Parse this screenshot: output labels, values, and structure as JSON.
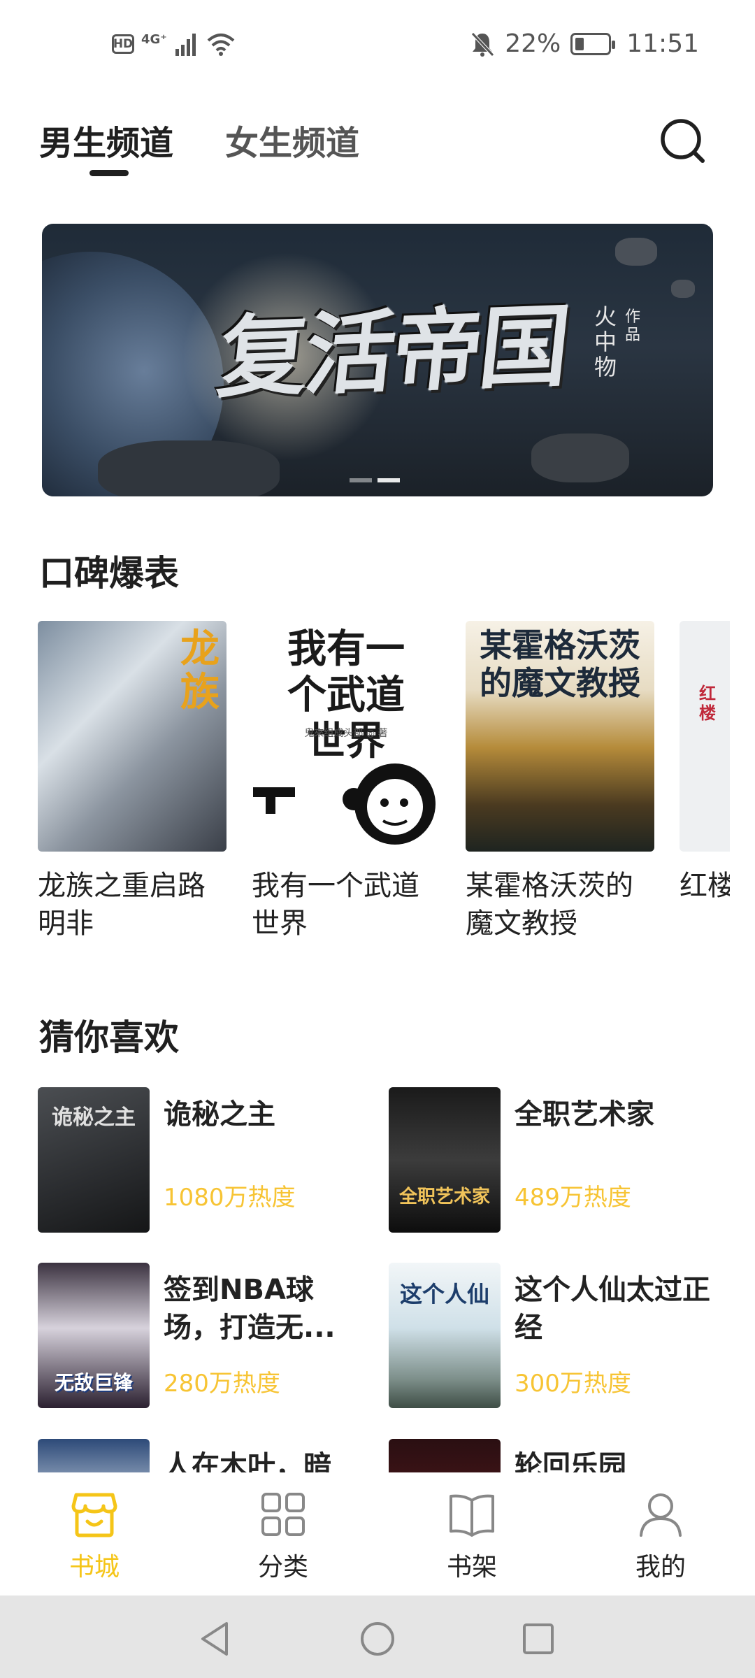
{
  "status_bar": {
    "hd": "HD",
    "network": "4G⁺",
    "battery": "22%",
    "time": "11:51"
  },
  "tabs": [
    {
      "label": "男生频道"
    },
    {
      "label": "女生频道"
    }
  ],
  "banner": {
    "title": "复活帝国",
    "author": "火中物",
    "author_tag": "作品"
  },
  "sections": {
    "popular": "口碑爆表",
    "guess": "猜你喜欢"
  },
  "popular_books": [
    {
      "title": "龙族之重启路明非",
      "cover_text": "龙族"
    },
    {
      "title": "我有一个武道世界",
      "cover_text": "我有一个武道世界",
      "cover_author": "鬼來组成头部 ◎ 著"
    },
    {
      "title": "某霍格沃茨的魔文教授",
      "cover_text": "某霍格沃茨的魔文教授"
    },
    {
      "title": "红楼",
      "cover_text": "红楼"
    }
  ],
  "guess_books": [
    {
      "title": "诡秘之主",
      "heat": "1080万热度",
      "cover_text": "诡秘之主"
    },
    {
      "title": "全职艺术家",
      "heat": "489万热度",
      "cover_text": "全职艺术家"
    },
    {
      "title": "签到NBA球场，打造无...",
      "heat": "280万热度",
      "cover_text": "无敌巨锋"
    },
    {
      "title": "这个人仙太过正经",
      "heat": "300万热度",
      "cover_text": "这个人仙"
    },
    {
      "title": "人在木叶，暗",
      "heat": "",
      "cover_text": ""
    },
    {
      "title": "轮回乐园",
      "heat": "",
      "cover_text": ""
    }
  ],
  "bottom_nav": [
    {
      "label": "书城",
      "icon": "store-icon"
    },
    {
      "label": "分类",
      "icon": "grid-icon"
    },
    {
      "label": "书架",
      "icon": "book-icon"
    },
    {
      "label": "我的",
      "icon": "user-icon"
    }
  ],
  "colors": {
    "accent": "#f5c518",
    "heat": "#f7c434",
    "text": "#1f1f1f"
  }
}
